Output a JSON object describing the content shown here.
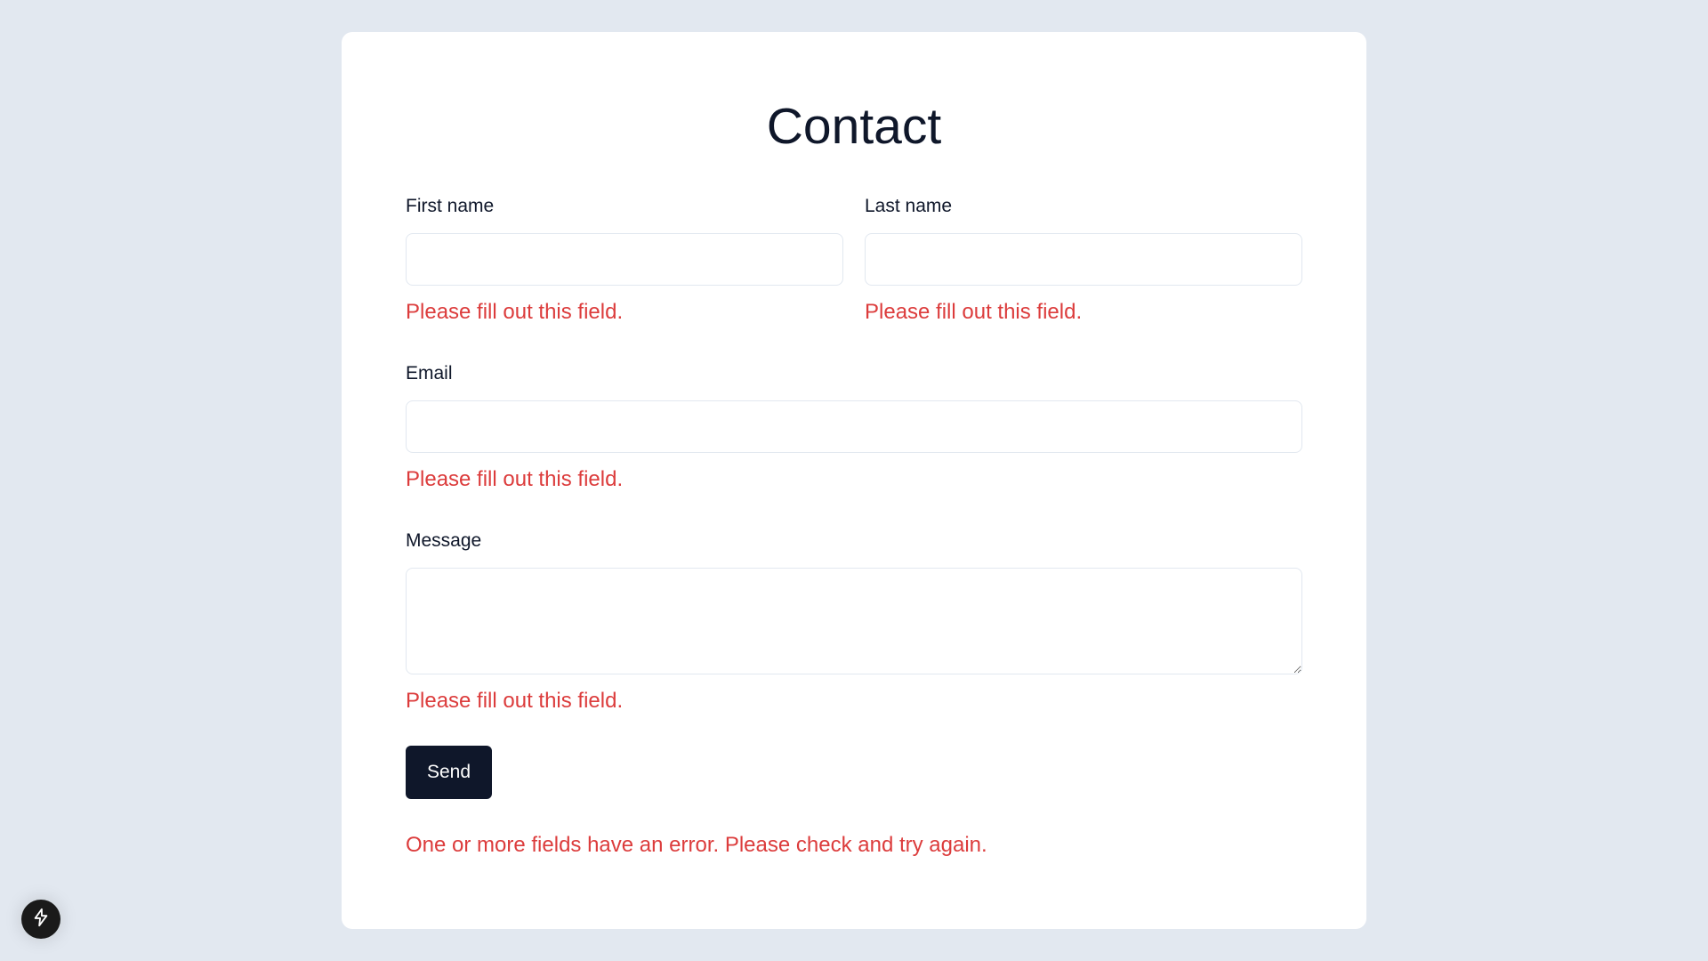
{
  "title": "Contact",
  "fields": {
    "first_name": {
      "label": "First name",
      "value": "",
      "error": "Please fill out this field."
    },
    "last_name": {
      "label": "Last name",
      "value": "",
      "error": "Please fill out this field."
    },
    "email": {
      "label": "Email",
      "value": "",
      "error": "Please fill out this field."
    },
    "message": {
      "label": "Message",
      "value": "",
      "error": "Please fill out this field."
    }
  },
  "send_label": "Send",
  "form_error": "One or more fields have an error. Please check and try again.",
  "colors": {
    "background": "#e2e8f0",
    "card": "#ffffff",
    "error": "#dc3c3c",
    "button": "#0f172a"
  },
  "icons": {
    "fab": "lightning-bolt-icon"
  }
}
